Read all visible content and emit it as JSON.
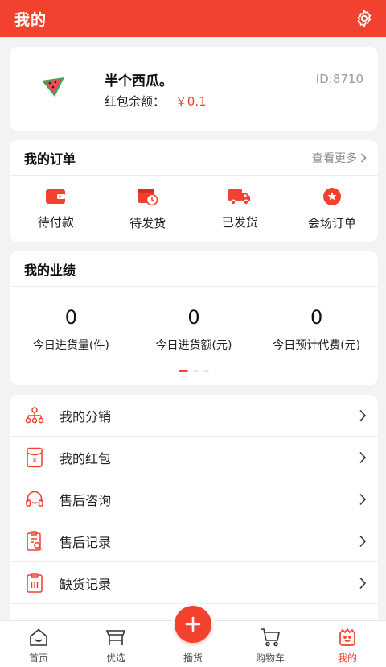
{
  "header": {
    "title": "我的",
    "settings_icon": "gear-icon"
  },
  "profile": {
    "avatar_icon": "watermelon-icon",
    "name": "半个西瓜。",
    "balance_label": "红包余额：",
    "balance_value": "￥0.1",
    "uid": "ID:8710"
  },
  "orders": {
    "title": "我的订单",
    "more": "查看更多",
    "items": [
      {
        "label": "待付款",
        "icon": "wallet-icon"
      },
      {
        "label": "待发货",
        "icon": "calendar-clock-icon"
      },
      {
        "label": "已发货",
        "icon": "truck-icon"
      },
      {
        "label": "会场订单",
        "icon": "star-badge-icon"
      }
    ]
  },
  "performance": {
    "title": "我的业绩",
    "stats": [
      {
        "value": "0",
        "label": "今日进货量(件)"
      },
      {
        "value": "0",
        "label": "今日进货额(元)"
      },
      {
        "value": "0",
        "label": "今日预计代费(元)"
      }
    ]
  },
  "menu": {
    "items": [
      {
        "label": "我的分销",
        "icon": "distribution-icon"
      },
      {
        "label": "我的红包",
        "icon": "red-envelope-icon"
      },
      {
        "label": "售后咨询",
        "icon": "headset-icon"
      },
      {
        "label": "售后记录",
        "icon": "clipboard-search-icon"
      },
      {
        "label": "缺货记录",
        "icon": "clipboard-list-icon"
      }
    ]
  },
  "tabbar": {
    "items": [
      {
        "label": "首页",
        "icon": "home-icon"
      },
      {
        "label": "优选",
        "icon": "stall-icon"
      },
      {
        "label": "播货",
        "icon": "plus-icon"
      },
      {
        "label": "购物车",
        "icon": "cart-icon"
      },
      {
        "label": "我的",
        "icon": "user-icon"
      }
    ],
    "active": "我的"
  },
  "colors": {
    "accent": "#f2412f",
    "background": "#f3f3f3"
  }
}
